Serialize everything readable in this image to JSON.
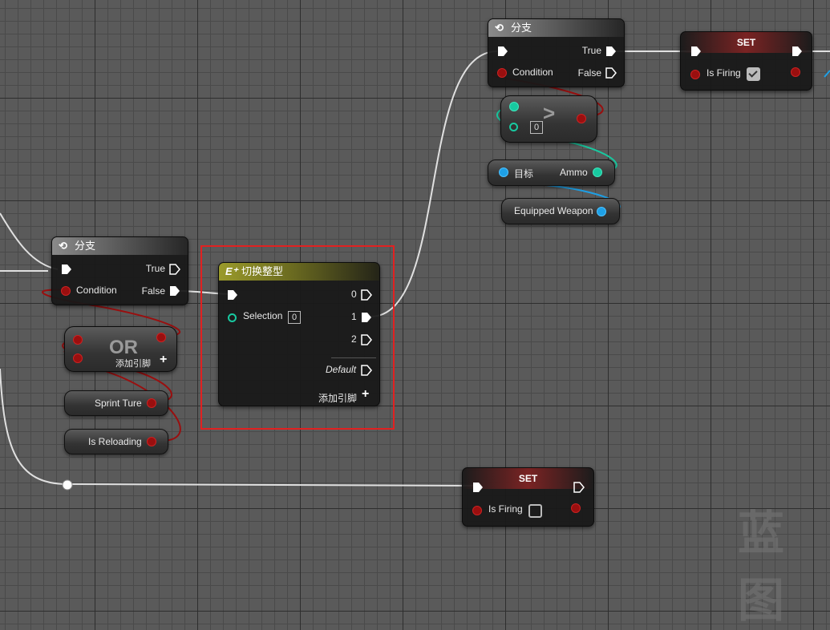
{
  "branch_top": {
    "title": "分支",
    "true_label": "True",
    "condition_label": "Condition",
    "false_label": "False"
  },
  "set_top": {
    "title": "SET",
    "var_label": "Is Firing",
    "checked": true
  },
  "greater": {
    "symbol": ">",
    "value": "0"
  },
  "ammo_getter": {
    "target_label": "目标",
    "output_label": "Ammo"
  },
  "equipped_weapon": {
    "label": "Equipped Weapon"
  },
  "branch_left": {
    "title": "分支",
    "true_label": "True",
    "condition_label": "Condition",
    "false_label": "False"
  },
  "switch_node": {
    "title": "切换整型",
    "selection_label": "Selection",
    "selection_value": "0",
    "out0": "0",
    "out1": "1",
    "out2": "2",
    "default_label": "Default",
    "add_pin_label": "添加引脚"
  },
  "or_node": {
    "title": "OR",
    "add_pin_label": "添加引脚"
  },
  "sprint_var": {
    "label": "Sprint Ture"
  },
  "reloading_var": {
    "label": "Is Reloading"
  },
  "set_bottom": {
    "title": "SET",
    "var_label": "Is Firing",
    "checked": false
  },
  "watermark": {
    "text": "蓝图"
  },
  "colors": {
    "exec": "#ffffff",
    "bool": "#9a0f0f",
    "int": "#18c9a0",
    "object": "#1ea0e6",
    "selection": "#e12121"
  }
}
